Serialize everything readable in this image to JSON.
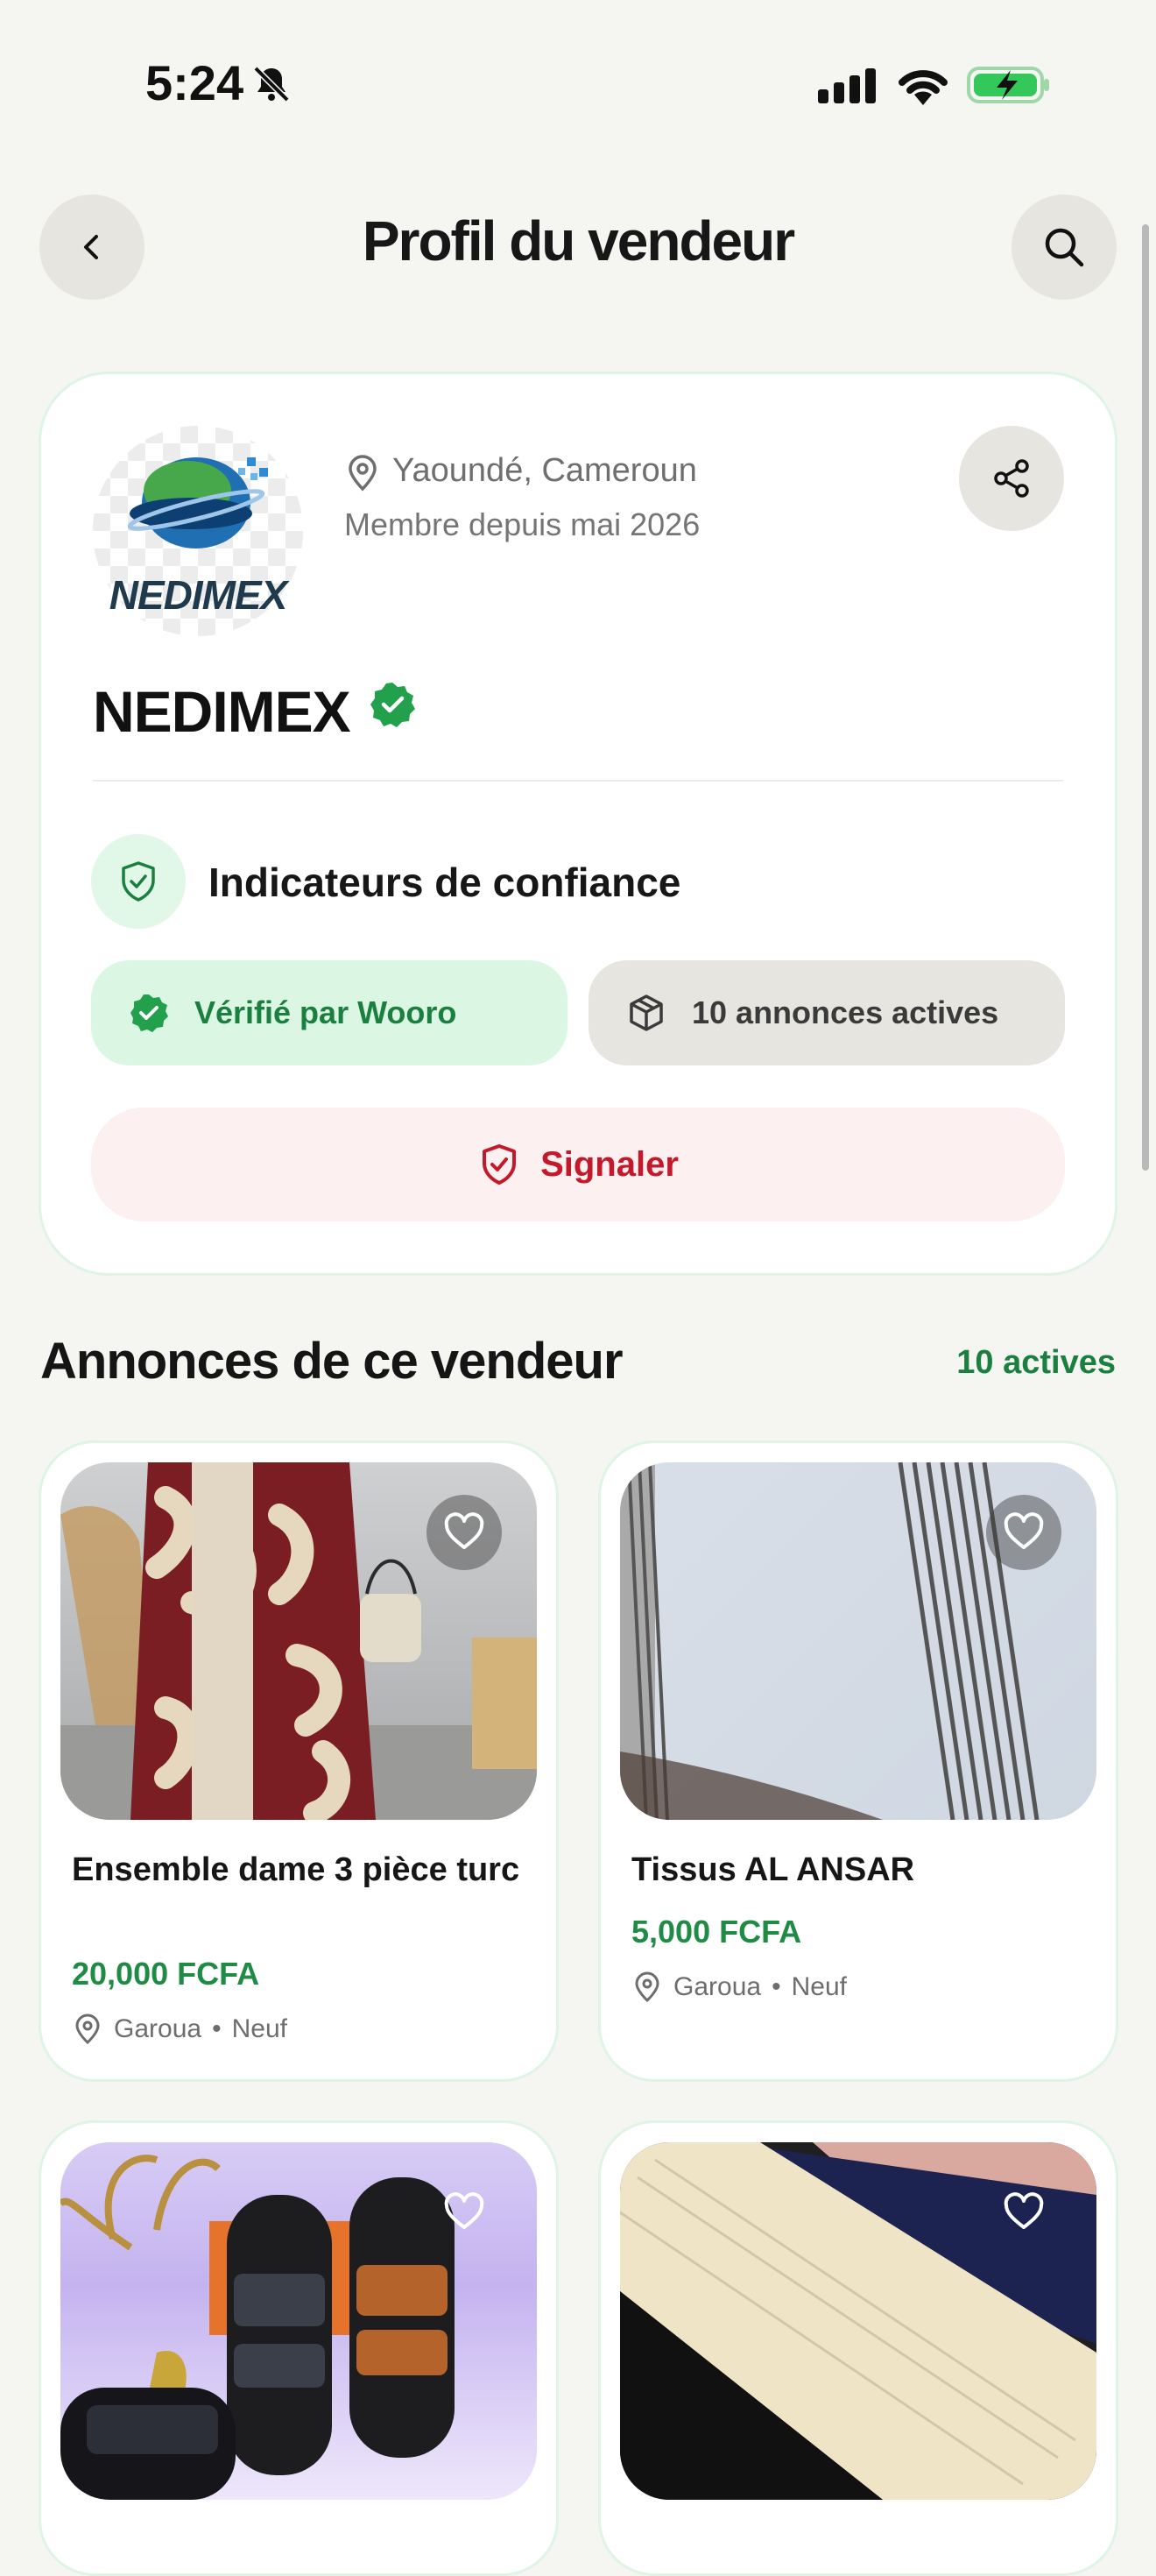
{
  "status_bar": {
    "time": "5:24",
    "icons": [
      "bell-muted-icon",
      "cellular-signal-icon",
      "wifi-icon",
      "battery-charging-icon"
    ]
  },
  "header": {
    "title": "Profil du vendeur",
    "back_icon": "chevron-left-icon",
    "search_icon": "search-icon"
  },
  "seller": {
    "logo_text": "NEDIMEX",
    "location": "Yaoundé, Cameroun",
    "member_since": "Membre depuis mai 2026",
    "name": "NEDIMEX",
    "verified": true,
    "share_icon": "share-icon"
  },
  "trust": {
    "title": "Indicateurs de confiance",
    "verified_label": "Vérifié par Wooro",
    "active_label": "10 annonces actives",
    "report_label": "Signaler"
  },
  "listings": {
    "title": "Annonces de ce vendeur",
    "count_label": "10 actives",
    "items": [
      {
        "title": "Ensemble dame 3 pièce turc",
        "price": "20,000 FCFA",
        "location": "Garoua",
        "condition": "Neuf"
      },
      {
        "title": "Tissus AL ANSAR",
        "price": "5,000 FCFA",
        "location": "Garoua",
        "condition": "Neuf"
      },
      {
        "title": "",
        "price": "",
        "location": "",
        "condition": ""
      },
      {
        "title": "",
        "price": "",
        "location": "",
        "condition": ""
      }
    ]
  },
  "colors": {
    "accent_green": "#1f8b45",
    "danger_red": "#c4192b",
    "background": "#f5f5f1"
  }
}
